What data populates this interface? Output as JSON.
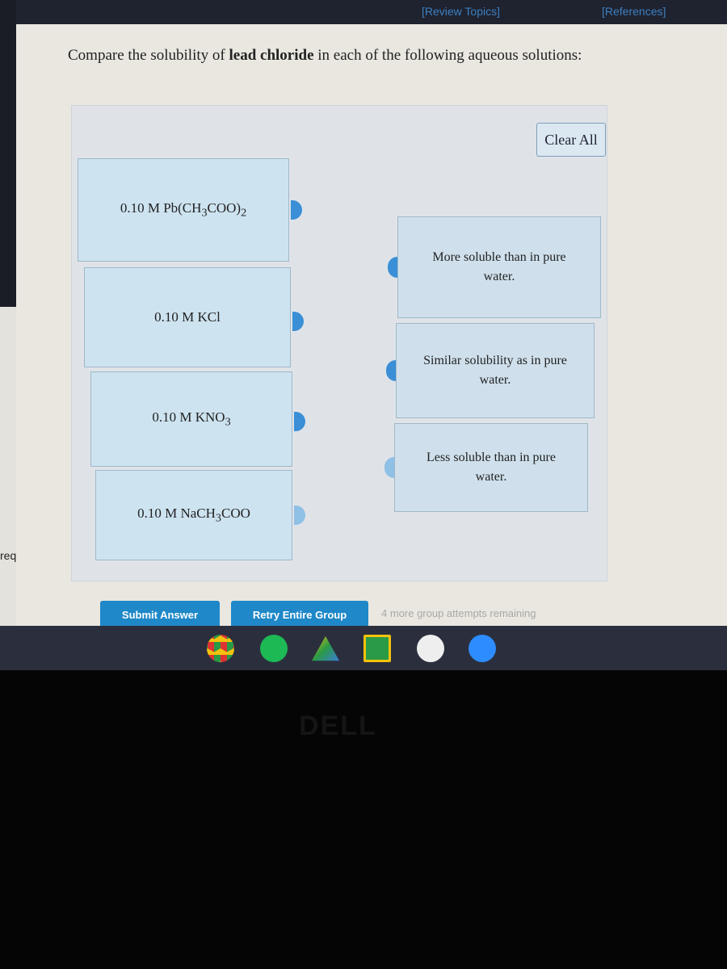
{
  "header": {
    "review_topics": "[Review Topics]",
    "references": "[References]"
  },
  "sidebar": {
    "partial_text": "req"
  },
  "question": {
    "prefix": "Compare the solubility of ",
    "bold": "lead chloride",
    "suffix": " in each of the following aqueous solutions:"
  },
  "clear_all": "Clear All",
  "items": [
    {
      "label": "0.10 M Pb(CH",
      "sub1": "3",
      "mid": "COO)",
      "sub2": "2"
    },
    {
      "label": "0.10 M KCl"
    },
    {
      "label": "0.10 M KNO",
      "sub1": "3"
    },
    {
      "label": "0.10 M NaCH",
      "sub1": "3",
      "mid": "COO"
    }
  ],
  "targets": [
    {
      "line1": "More soluble than in pure",
      "line2": "water."
    },
    {
      "line1": "Similar solubility as in pure",
      "line2": "water."
    },
    {
      "line1": "Less soluble than in pure",
      "line2": "water."
    }
  ],
  "buttons": {
    "submit": "Submit Answer",
    "retry": "Retry Entire Group"
  },
  "attempts": "4 more group attempts remaining",
  "shelf_apps": [
    "chrome-icon",
    "spotify-icon",
    "drive-icon",
    "classroom-icon",
    "play-store-icon",
    "zoom-icon"
  ],
  "colors": {
    "accent": "#1e88c8",
    "item_bg": "#cde3f0",
    "nub": "#3a8fd6"
  },
  "bezel_logo": "DELL"
}
